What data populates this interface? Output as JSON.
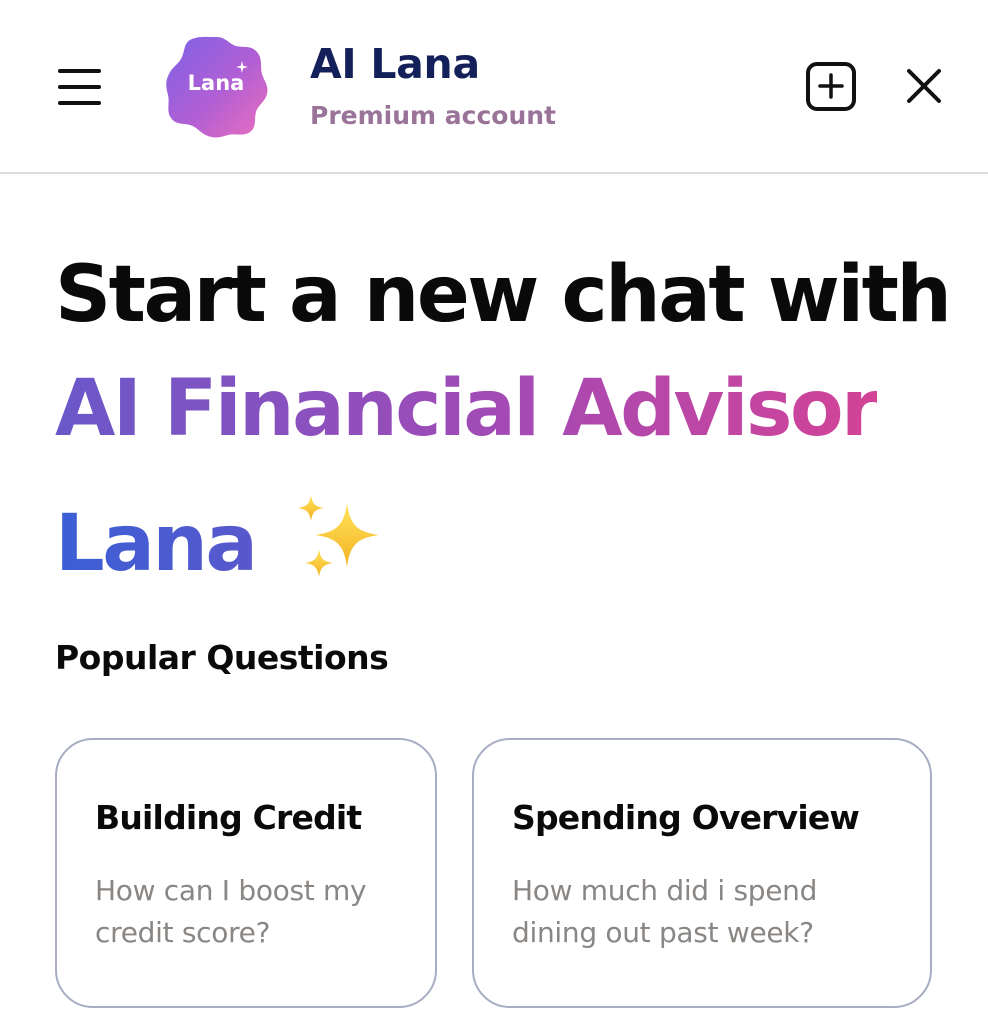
{
  "header": {
    "avatar_text": "Lana",
    "title": "AI Lana",
    "subtitle": "Premium account"
  },
  "icons": {
    "menu": "hamburger-menu-icon",
    "new_chat": "square-plus-icon",
    "close": "close-x-icon",
    "sparkles": "sparkles-emoji-icon"
  },
  "hero": {
    "line1": "Start a new chat with",
    "line2": "AI Financial Advisor",
    "line3": "Lana"
  },
  "popular": {
    "title": "Popular Questions",
    "cards": [
      {
        "title": "Building Credit",
        "question": "How can I boost my credit score?"
      },
      {
        "title": "Spending Overview",
        "question": "How much did i spend dining out past week?"
      }
    ]
  },
  "colors": {
    "brand_navy": "#14205a",
    "subtitle_mauve": "#9a7398",
    "gradient_purple": "#6a58c9",
    "gradient_pink": "#d34396",
    "gradient_blue": "#3a5fd6",
    "card_border": "#a7adc2",
    "muted_text": "#8a8683"
  }
}
